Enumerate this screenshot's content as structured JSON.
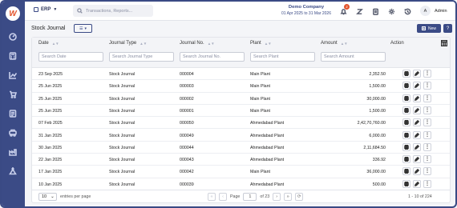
{
  "app": {
    "logo_letter": "W",
    "module": "ERP"
  },
  "search": {
    "placeholder": "Transactions, Reports..."
  },
  "company": {
    "name": "Demo Company",
    "period": "01 Apr 2025 to 31 Mar 2026"
  },
  "notifications": {
    "count": "2"
  },
  "user": {
    "initial": "A",
    "name": "Admin"
  },
  "page": {
    "title": "Stock Journal",
    "new_label": "New",
    "help_label": "?"
  },
  "table": {
    "headers": {
      "date": "Date",
      "journal_type": "Journal Type",
      "journal_no": "Journal No.",
      "plant": "Plant",
      "amount": "Amount",
      "action": "Action"
    },
    "filters": {
      "date": "Search Date",
      "journal_type": "Search Journal Type",
      "journal_no": "Search Journal No.",
      "plant": "Search Plant",
      "amount": "Search Amount"
    },
    "rows": [
      {
        "date": "23 Sep 2025",
        "type": "Stock Journal",
        "no": "000004",
        "plant": "Main Plant",
        "amount": "2,352.50"
      },
      {
        "date": "25 Jun 2025",
        "type": "Stock Journal",
        "no": "000003",
        "plant": "Main Plant",
        "amount": "1,500.00"
      },
      {
        "date": "25 Jun 2025",
        "type": "Stock Journal",
        "no": "000002",
        "plant": "Main Plant",
        "amount": "30,000.00"
      },
      {
        "date": "25 Jun 2025",
        "type": "Stock Journal",
        "no": "000001",
        "plant": "Main Plant",
        "amount": "1,500.00"
      },
      {
        "date": "07 Feb 2025",
        "type": "Stock Journal",
        "no": "000050",
        "plant": "Ahmedabad Plant",
        "amount": "2,42,70,760.00"
      },
      {
        "date": "31 Jan 2025",
        "type": "Stock Journal",
        "no": "000049",
        "plant": "Ahmedabad Plant",
        "amount": "6,000.00"
      },
      {
        "date": "30 Jan 2025",
        "type": "Stock Journal",
        "no": "000044",
        "plant": "Ahmedabad Plant",
        "amount": "2,11,684.50"
      },
      {
        "date": "22 Jan 2025",
        "type": "Stock Journal",
        "no": "000043",
        "plant": "Ahmedabad Plant",
        "amount": "336.92"
      },
      {
        "date": "17 Jan 2025",
        "type": "Stock Journal",
        "no": "000042",
        "plant": "Main Plant",
        "amount": "36,000.00"
      },
      {
        "date": "10 Jan 2025",
        "type": "Stock Journal",
        "no": "000039",
        "plant": "Ahmedabad Plant",
        "amount": "500.00"
      }
    ]
  },
  "pagination": {
    "page_size": "10",
    "page_size_label": "entries per page",
    "page_label": "Page",
    "current_page": "1",
    "of_pages": "of 23",
    "range": "1 - 10 of 224"
  }
}
